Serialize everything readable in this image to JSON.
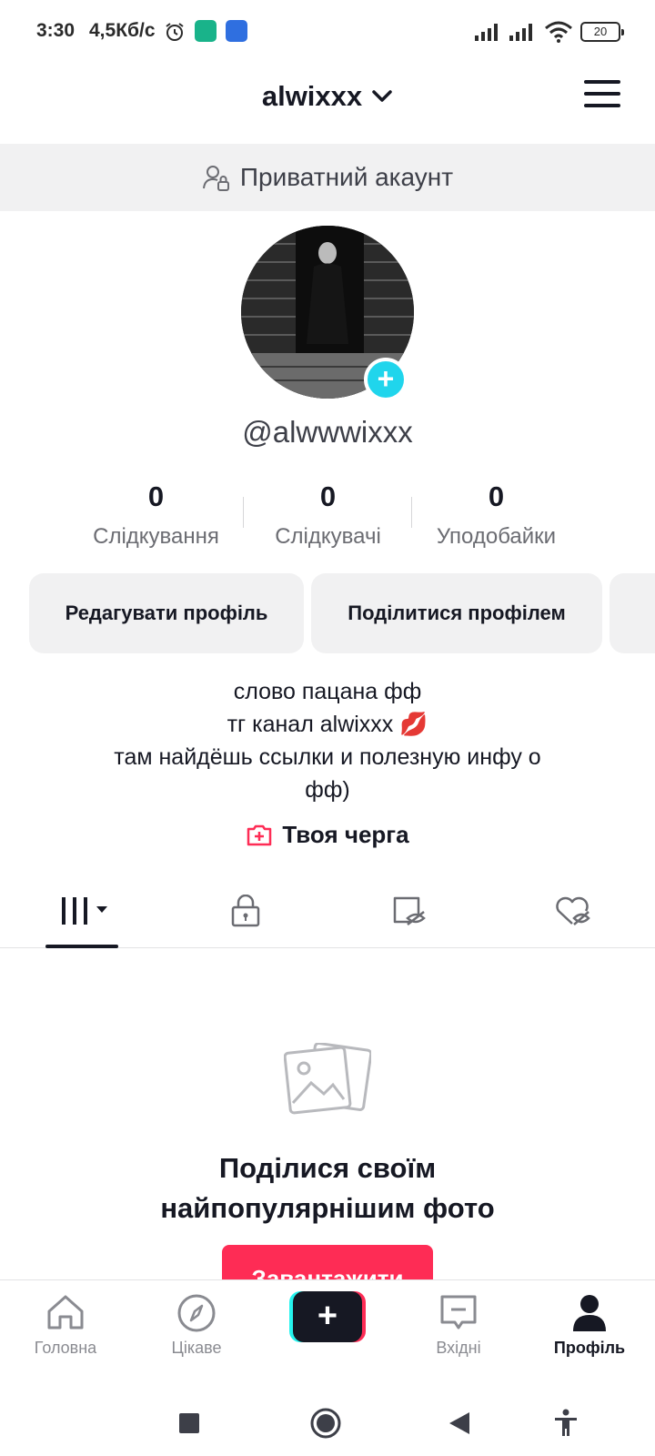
{
  "status_bar": {
    "time": "3:30",
    "speed": "4,5Кб/с",
    "battery": "20",
    "icons": [
      "alarm-icon",
      "app-shield-icon",
      "app-arrow-icon",
      "signal-icon",
      "signal-icon",
      "wifi-icon",
      "battery-icon"
    ]
  },
  "header": {
    "username": "alwixxx",
    "dropdown_icon": "chevron-down-icon",
    "menu_icon": "hamburger-menu-icon"
  },
  "private_banner": {
    "icon": "private-user-lock-icon",
    "text": "Приватний акаунт"
  },
  "profile": {
    "handle": "@alwwwixxx",
    "stats": [
      {
        "value": "0",
        "label": "Слідкування"
      },
      {
        "value": "0",
        "label": "Слідкувачі"
      },
      {
        "value": "0",
        "label": "Уподобайки"
      }
    ],
    "buttons": {
      "edit": "Редагувати профіль",
      "share": "Поділитися профілем"
    },
    "bio_lines": [
      "слово пацана фф",
      "тг канал alwixxx 💋",
      "там найдёшь ссылки и полезную инфу о",
      "фф)"
    ],
    "queue_label": "Твоя черга"
  },
  "tabs": [
    "grid-videos-icon",
    "private-lock-icon",
    "reposts-hidden-icon",
    "liked-hidden-icon"
  ],
  "empty_state": {
    "title_line1": "Поділися своїм",
    "title_line2": "найпопулярнішим фото",
    "button": "Завантажити"
  },
  "bottom_nav": [
    {
      "label": "Головна",
      "icon": "home-icon"
    },
    {
      "label": "Цікаве",
      "icon": "compass-icon"
    },
    {
      "label": "",
      "icon": "create-plus-icon"
    },
    {
      "label": "Вхідні",
      "icon": "inbox-icon"
    },
    {
      "label": "Профіль",
      "icon": "profile-icon"
    }
  ],
  "colors": {
    "accent": "#fe2c55",
    "cyan": "#20d5ec",
    "text": "#161823",
    "muted": "#6b6c72"
  }
}
